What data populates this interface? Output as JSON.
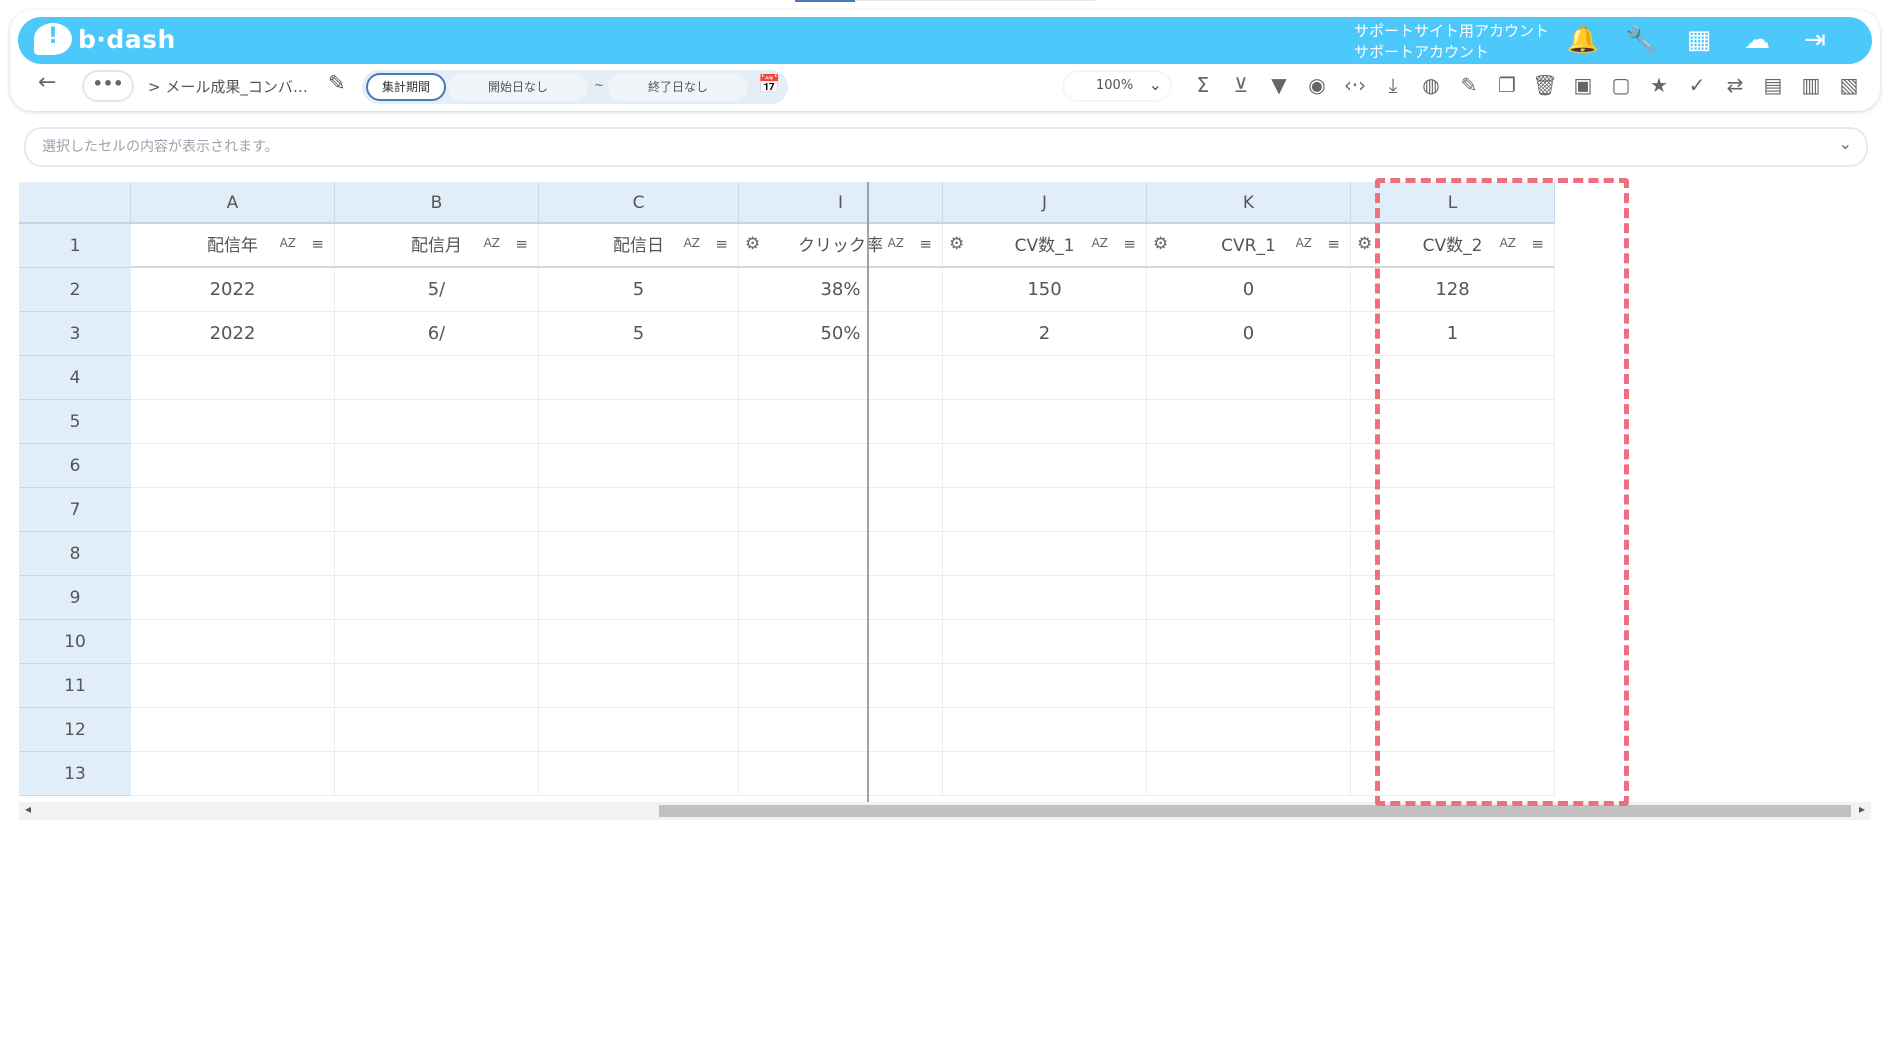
{
  "app": {
    "logo_text": "b·dash",
    "account_line1": "サポートサイト用アカウント",
    "account_line2": "サポートアカウント"
  },
  "top_icons": [
    {
      "name": "bell-icon",
      "glyph": "🔔"
    },
    {
      "name": "wrench-icon",
      "glyph": "🔧"
    },
    {
      "name": "apps-grid-icon",
      "glyph": "▦"
    },
    {
      "name": "chat-bot-icon",
      "glyph": "☁"
    },
    {
      "name": "logout-icon",
      "glyph": "⇥"
    }
  ],
  "toolbar": {
    "back": "←",
    "more": "•••",
    "breadcrumb": "> メール成果_コンバ…",
    "edit_icon": "✎",
    "period_label": "集計期間",
    "start_date": "開始日なし",
    "tilde": "~",
    "end_date": "終了日なし",
    "calendar_icon": "📅",
    "zoom": "100%",
    "zoom_chevron": "⌄"
  },
  "tools": [
    {
      "name": "sum-icon",
      "glyph": "Σ"
    },
    {
      "name": "filter-clear-icon",
      "glyph": "⊻"
    },
    {
      "name": "filter-icon",
      "glyph": "▼"
    },
    {
      "name": "eye-icon",
      "glyph": "◉"
    },
    {
      "name": "code-icon",
      "glyph": "‹·›"
    },
    {
      "name": "download-icon",
      "glyph": "⤓"
    },
    {
      "name": "chart-icon",
      "glyph": "◍"
    },
    {
      "name": "edit-note-icon",
      "glyph": "✎"
    },
    {
      "name": "copy-icon",
      "glyph": "❐"
    },
    {
      "name": "trash-icon",
      "glyph": "🗑"
    },
    {
      "name": "archive-icon",
      "glyph": "▣"
    },
    {
      "name": "archive-disabled-icon",
      "glyph": "▢"
    },
    {
      "name": "star-icon",
      "glyph": "★"
    },
    {
      "name": "user-check-icon",
      "glyph": "✓"
    },
    {
      "name": "repeat-icon",
      "glyph": "⇄"
    },
    {
      "name": "calendar-icon",
      "glyph": "▤"
    },
    {
      "name": "document-icon",
      "glyph": "▥"
    },
    {
      "name": "clipboard-icon",
      "glyph": "▧"
    }
  ],
  "formula_bar": {
    "placeholder": "選択したセルの内容が表示されます。",
    "chevron": "⌄"
  },
  "sheet": {
    "column_letters": [
      "A",
      "B",
      "C",
      "I",
      "J",
      "K",
      "L"
    ],
    "row_numbers": [
      "1",
      "2",
      "3",
      "4",
      "5",
      "6",
      "7",
      "8",
      "9",
      "10",
      "11",
      "12",
      "13"
    ],
    "headers": [
      "配信年",
      "配信月",
      "配信日",
      "クリック率",
      "CV数_1",
      "CVR_1",
      "CV数_2"
    ],
    "sort_label": "AZ",
    "filter_glyph": "≡",
    "gear_glyph": "⚙",
    "rows": [
      [
        "2022",
        "5/",
        "5",
        "38%",
        "150",
        "0",
        "128"
      ],
      [
        "2022",
        "6/",
        "5",
        "50%",
        "2",
        "0",
        "1"
      ]
    ],
    "highlighted_column": "K"
  },
  "scrollbar": {
    "left": "◂",
    "right": "▸"
  }
}
